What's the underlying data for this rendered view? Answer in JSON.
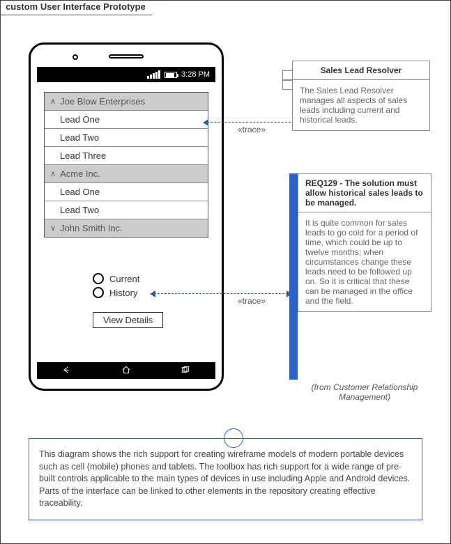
{
  "frame": {
    "title": "custom User Interface Prototype"
  },
  "phone": {
    "time": "3:28 PM",
    "list": {
      "groups": [
        {
          "expanded": true,
          "label": "Joe Blow Enterprises",
          "items": [
            "Lead One",
            "Lead Two",
            "Lead Three"
          ]
        },
        {
          "expanded": true,
          "label": "Acme Inc.",
          "items": [
            "Lead One",
            "Lead Two"
          ]
        },
        {
          "expanded": false,
          "label": "John Smith Inc.",
          "items": []
        }
      ]
    },
    "radios": {
      "current": "Current",
      "history": "History"
    },
    "view_button": "View Details"
  },
  "trace_label_1": "«trace»",
  "trace_label_2": "«trace»",
  "box1": {
    "title": "Sales Lead Resolver",
    "body": "The Sales Lead Resolver manages all aspects of sales leads including current and historical leads."
  },
  "box2": {
    "title": "REQ129 - The solution must allow historical sales leads to be managed.",
    "body": "It is quite common for sales leads to go cold for a period of time, which could be up to twelve months; when circumstances change these leads need to be followed up on. So it is critical that these can be managed in the office and the field."
  },
  "box2_caption": "(from Customer Relationship Management)",
  "note": "This diagram shows the rich support for creating wireframe models of modern portable devices such as cell (mobile) phones and tablets. The toolbox has rich support for a wide range of pre-built controls applicable to the main types of devices in use including Apple and Android devices. Parts of the interface can be linked to other elements in the repository creating effective traceability."
}
